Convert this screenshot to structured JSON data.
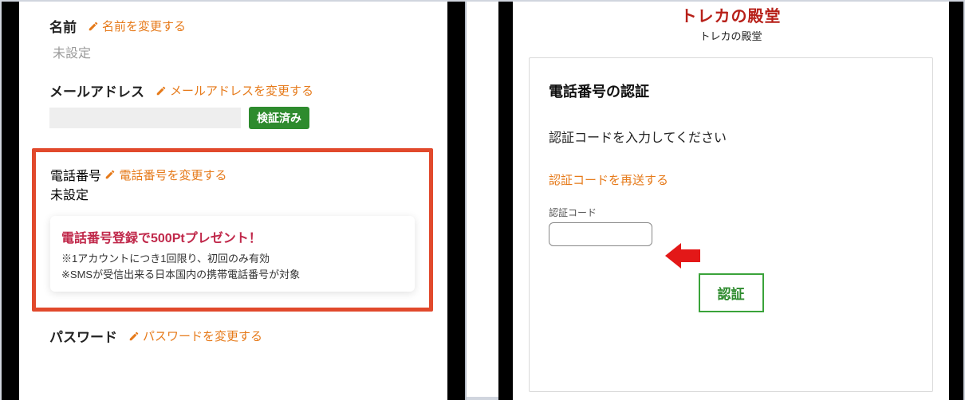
{
  "left": {
    "name": {
      "label": "名前",
      "edit": "名前を変更する",
      "value": "未設定"
    },
    "email": {
      "label": "メールアドレス",
      "edit": "メールアドレスを変更する",
      "value": "",
      "verified_badge": "検証済み"
    },
    "phone": {
      "label": "電話番号",
      "edit": "電話番号を変更する",
      "value": "未設定",
      "promo_title": "電話番号登録で500Ptプレゼント！",
      "promo_note1": "※1アカウントにつき1回限り、初回のみ有効",
      "promo_note2": "※SMSが受信出来る日本国内の携帯電話番号が対象"
    },
    "password": {
      "label": "パスワード",
      "edit": "パスワードを変更する"
    }
  },
  "right": {
    "logo": "トレカの殿堂",
    "logo_sub": "トレカの殿堂",
    "title": "電話番号の認証",
    "lead": "認証コードを入力してください",
    "resend": "認証コードを再送する",
    "code_label": "認証コード",
    "code_value": "",
    "verify_button": "認証"
  },
  "colors": {
    "accent_orange": "#e67a1a",
    "accent_red_border": "#e1492c",
    "brand_red": "#b72019",
    "verified_green": "#2e8b2e"
  }
}
